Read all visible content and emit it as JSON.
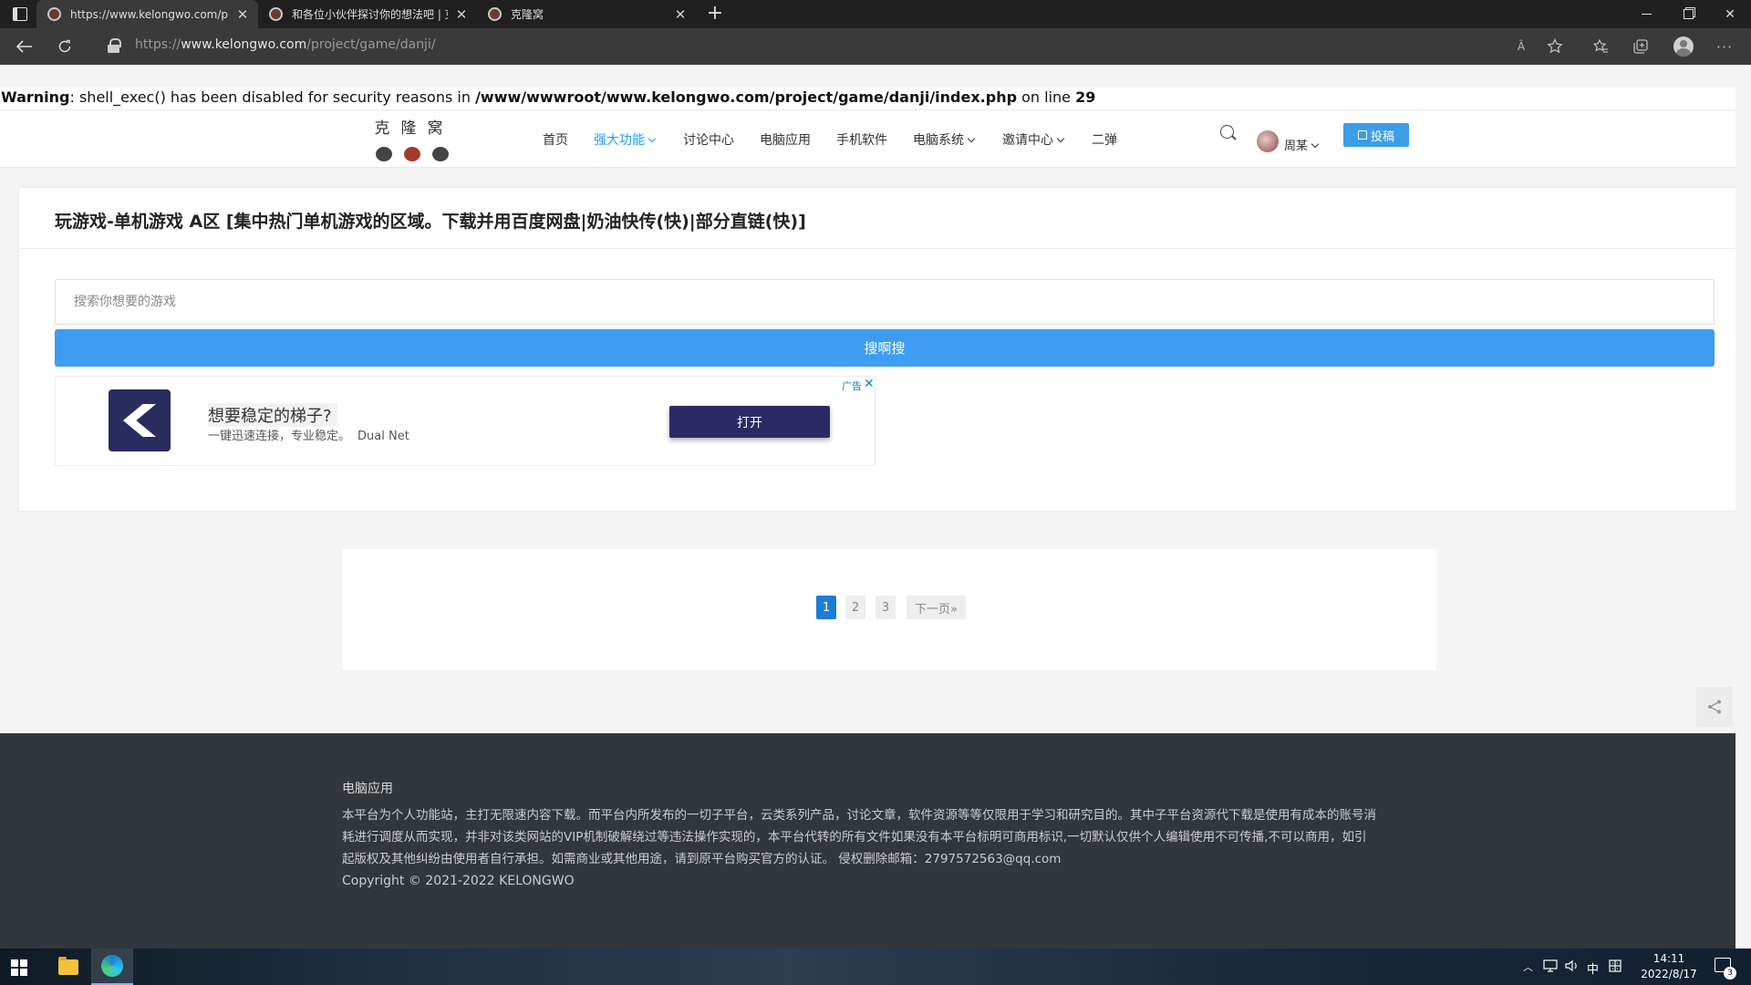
{
  "browser": {
    "tabs": [
      {
        "title": "https://www.kelongwo.com/pro",
        "active": true
      },
      {
        "title": "和各位小伙伴探讨你的想法吧 | 克",
        "active": false
      },
      {
        "title": "克隆窝",
        "active": false
      }
    ],
    "new_tab": "+",
    "close_glyph": "✕",
    "url_prefix": "https://",
    "url_domain": "www.kelongwo.com",
    "url_path": "/project/game/danji/",
    "read_aloud": "Â",
    "window": {
      "minimize": "",
      "restore": "",
      "close": "✕"
    }
  },
  "warning": {
    "label": "Warning",
    "text1": ": shell_exec() has been disabled for security reasons in ",
    "path": "/www/wwwroot/www.kelongwo.com/project/game/danji/index.php",
    "text2": " on line ",
    "line": "29"
  },
  "site": {
    "logo_text": "克隆窝",
    "nav": [
      {
        "label": "首页",
        "dropdown": false,
        "active": false
      },
      {
        "label": "强大功能",
        "dropdown": true,
        "active": true
      },
      {
        "label": "讨论中心",
        "dropdown": false,
        "active": false
      },
      {
        "label": "电脑应用",
        "dropdown": false,
        "active": false
      },
      {
        "label": "手机软件",
        "dropdown": false,
        "active": false
      },
      {
        "label": "电脑系统",
        "dropdown": true,
        "active": false
      },
      {
        "label": "邀请中心",
        "dropdown": true,
        "active": false
      },
      {
        "label": "二弹",
        "dropdown": false,
        "active": false
      }
    ],
    "user_name": "周某",
    "publish_label": "投稿"
  },
  "main": {
    "title": "玩游戏-单机游戏 A区 [集中热门单机游戏的区域。下载并用百度网盘|奶油快传(快)|部分直链(快)]",
    "search_placeholder": "搜索你想要的游戏",
    "search_button": "搜啊搜",
    "ad": {
      "headline": "想要稳定的梯子?",
      "subline": "一键迅速连接，专业稳定。",
      "brand": "Dual Net",
      "button": "打开",
      "ad_label": "广告",
      "close": "✕"
    }
  },
  "pagination": {
    "pages": [
      "1",
      "2",
      "3"
    ],
    "current": "1",
    "next": "下一页»"
  },
  "footer": {
    "title": "电脑应用",
    "text": "本平台为个人功能站，主打无限速内容下载。而平台内所发布的一切子平台，云类系列产品，讨论文章，软件资源等等仅限用于学习和研究目的。其中子平台资源代下载是使用有成本的账号消耗进行调度从而实现，并非对该类网站的VIP机制破解绕过等违法操作实现的，本平台代转的所有文件如果没有本平台标明可商用标识,一切默认仅供个人编辑使用不可传播,不可以商用，如引起版权及其他纠纷由使用者自行承担。如需商业或其他用途，请到原平台购买官方的认证。 侵权删除邮箱：2797572563@qq.com",
    "copyright": "Copyright © 2021-2022 KELONGWO"
  },
  "taskbar": {
    "ime": "中",
    "time": "14:11",
    "date": "2022/8/17",
    "notifications": "3"
  }
}
